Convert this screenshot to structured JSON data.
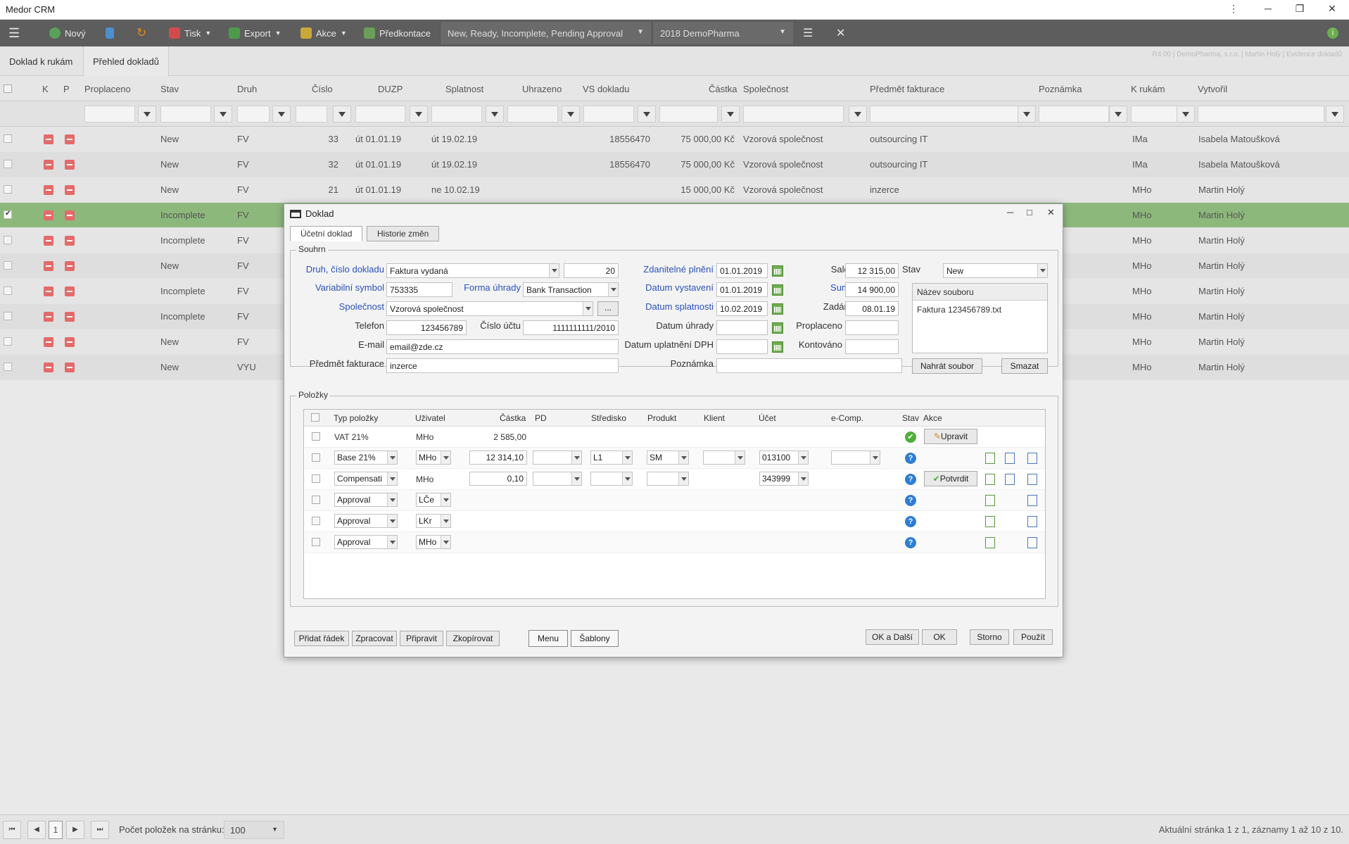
{
  "app": {
    "title": "Medor CRM"
  },
  "toolbar": {
    "new_label": "Nový",
    "print_label": "Tisk",
    "export_label": "Export",
    "actions_label": "Akce",
    "precontact_label": "Předkontace",
    "status_filter": "New, Ready, Incomplete, Pending Approval",
    "company_filter": "2018 DemoPharma"
  },
  "tabs": [
    {
      "label": "Doklad k rukám"
    },
    {
      "label": "Přehled dokladů"
    }
  ],
  "version_info": "R4.00 | DemoPharma, s.r.o. | Martin Holý | Evidence dokladů",
  "columns": {
    "k": "K",
    "p": "P",
    "proplaceno": "Proplaceno",
    "stav": "Stav",
    "druh": "Druh",
    "cislo": "Číslo",
    "duzp": "DUZP",
    "splatnost": "Splatnost",
    "uhrazeno": "Uhrazeno",
    "vs": "VS dokladu",
    "castka": "Částka",
    "spolecnost": "Společnost",
    "predmet": "Předmět fakturace",
    "poznamka": "Poznámka",
    "krukam": "K rukám",
    "vytvoril": "Vytvořil"
  },
  "rows": [
    {
      "stav": "New",
      "druh": "FV",
      "cislo": "33",
      "duzp": "út 01.01.19",
      "splatnost": "út 19.02.19",
      "vs": "18556470",
      "castka": "75 000,00 Kč",
      "spolecnost": "Vzorová společnost",
      "predmet": "outsourcing IT",
      "krukam": "IMa",
      "vytvoril": "Isabela Matoušková"
    },
    {
      "stav": "New",
      "druh": "FV",
      "cislo": "32",
      "duzp": "út 01.01.19",
      "splatnost": "út 19.02.19",
      "vs": "18556470",
      "castka": "75 000,00 Kč",
      "spolecnost": "Vzorová společnost",
      "predmet": "outsourcing IT",
      "krukam": "IMa",
      "vytvoril": "Isabela Matoušková"
    },
    {
      "stav": "New",
      "druh": "FV",
      "cislo": "21",
      "duzp": "út 01.01.19",
      "splatnost": "ne 10.02.19",
      "vs": "",
      "castka": "15 000,00 Kč",
      "spolecnost": "Vzorová společnost",
      "predmet": "inzerce",
      "krukam": "MHo",
      "vytvoril": "Martin Holý"
    },
    {
      "stav": "Incomplete",
      "druh": "FV",
      "cislo": "",
      "duzp": "",
      "splatnost": "",
      "vs": "",
      "castka": "",
      "spolecnost": "",
      "predmet": "",
      "krukam": "MHo",
      "vytvoril": "Martin Holý"
    },
    {
      "stav": "Incomplete",
      "druh": "FV",
      "cislo": "",
      "duzp": "",
      "splatnost": "",
      "vs": "",
      "castka": "",
      "spolecnost": "",
      "predmet": "",
      "krukam": "MHo",
      "vytvoril": "Martin Holý"
    },
    {
      "stav": "New",
      "druh": "FV",
      "cislo": "",
      "duzp": "",
      "splatnost": "",
      "vs": "",
      "castka": "",
      "spolecnost": "",
      "predmet": "",
      "krukam": "MHo",
      "vytvoril": "Martin Holý"
    },
    {
      "stav": "Incomplete",
      "druh": "FV",
      "cislo": "",
      "duzp": "",
      "splatnost": "",
      "vs": "",
      "castka": "",
      "spolecnost": "",
      "predmet": "",
      "krukam": "MHo",
      "vytvoril": "Martin Holý"
    },
    {
      "stav": "Incomplete",
      "druh": "FV",
      "cislo": "",
      "duzp": "",
      "splatnost": "",
      "vs": "",
      "castka": "",
      "spolecnost": "",
      "predmet": "",
      "krukam": "MHo",
      "vytvoril": "Martin Holý"
    },
    {
      "stav": "New",
      "druh": "FV",
      "cislo": "",
      "duzp": "",
      "splatnost": "",
      "vs": "",
      "castka": "",
      "spolecnost": "",
      "predmet": "",
      "krukam": "MHo",
      "vytvoril": "Martin Holý"
    },
    {
      "stav": "New",
      "druh": "VYU",
      "cislo": "",
      "duzp": "",
      "splatnost": "",
      "vs": "",
      "castka": "",
      "spolecnost": "",
      "predmet": "",
      "krukam": "MHo",
      "vytvoril": "Martin Holý"
    }
  ],
  "modal": {
    "title": "Doklad",
    "tabs": [
      "Účetní doklad",
      "Historie změn"
    ],
    "summary_legend": "Souhrn",
    "items_legend": "Položky",
    "labels": {
      "druh": "Druh, číslo dokladu",
      "vs": "Variabilní symbol",
      "forma": "Forma úhrady",
      "spolecnost": "Společnost",
      "telefon": "Telefon",
      "cislo_uctu": "Číslo účtu",
      "email": "E-mail",
      "predmet": "Předmět fakturace",
      "zdanitelne": "Zdanitelné plnění",
      "vystaveni": "Datum vystavení",
      "splatnosti": "Datum splatnosti",
      "uhrady": "Datum úhrady",
      "dph": "Datum uplatnění DPH",
      "poznamka": "Poznámka",
      "saldo": "Saldo",
      "suma": "Suma",
      "zadano": "Zadáno",
      "proplaceno": "Proplaceno",
      "kontovano": "Kontováno",
      "stav": "Stav"
    },
    "values": {
      "druh": "Faktura vydaná",
      "cislo": "20",
      "vs": "753335",
      "forma": "Bank Transaction",
      "spolecnost": "Vzorová společnost",
      "telefon": "123456789",
      "cislo_uctu": "1111111111/2010",
      "email": "email@zde.cz",
      "predmet": "inzerce",
      "zdanitelne": "01.01.2019",
      "vystaveni": "01.01.2019",
      "splatnosti": "10.02.2019",
      "saldo": "12 315,00",
      "suma": "14 900,00",
      "zadano": "08.01.19",
      "stav": "New"
    },
    "files": {
      "header": "Název souboru",
      "items": [
        "Faktura 123456789.txt"
      ],
      "upload": "Nahrát soubor",
      "delete": "Smazat"
    },
    "items_columns": {
      "typ": "Typ položky",
      "uzivatel": "Uživatel",
      "castka": "Částka",
      "pd": "PD",
      "stredisko": "Středisko",
      "produkt": "Produkt",
      "klient": "Klient",
      "ucet": "Účet",
      "ecomp": "e-Comp.",
      "stav": "Stav",
      "akce": "Akce"
    },
    "items": [
      {
        "typ": "VAT 21%",
        "uzivatel": "MHo",
        "castka": "2 585,00",
        "akce": "Upravit"
      },
      {
        "typ": "Base 21%",
        "uzivatel": "MHo",
        "castka": "12 314,10",
        "stredisko": "L1",
        "produkt": "SM",
        "ucet": "013100"
      },
      {
        "typ": "Compensati",
        "uzivatel": "MHo",
        "castka": "0,10",
        "ucet": "343999",
        "akce": "Potvrdit"
      },
      {
        "typ": "Approval",
        "uzivatel": "LČe"
      },
      {
        "typ": "Approval",
        "uzivatel": "LKr"
      },
      {
        "typ": "Approval",
        "uzivatel": "MHo"
      }
    ],
    "buttons": {
      "add_row": "Přidat řádek",
      "process": "Zpracovat",
      "prepare": "Připravit",
      "copy": "Zkopírovat",
      "menu": "Menu",
      "templates": "Šablony",
      "ok_next": "OK a Další",
      "ok": "OK",
      "cancel": "Storno",
      "apply": "Použít"
    }
  },
  "footer": {
    "page": "1",
    "per_page_label": "Počet položek na stránku:",
    "per_page": "100",
    "summary": "Aktuální stránka 1 z 1, záznamy 1 až 10 z 10."
  },
  "colors": {
    "toolbar": "#5d5d5d",
    "selected_row": "#8db87c",
    "link_blue": "#2a52be",
    "red_flag": "#e46a6a"
  }
}
